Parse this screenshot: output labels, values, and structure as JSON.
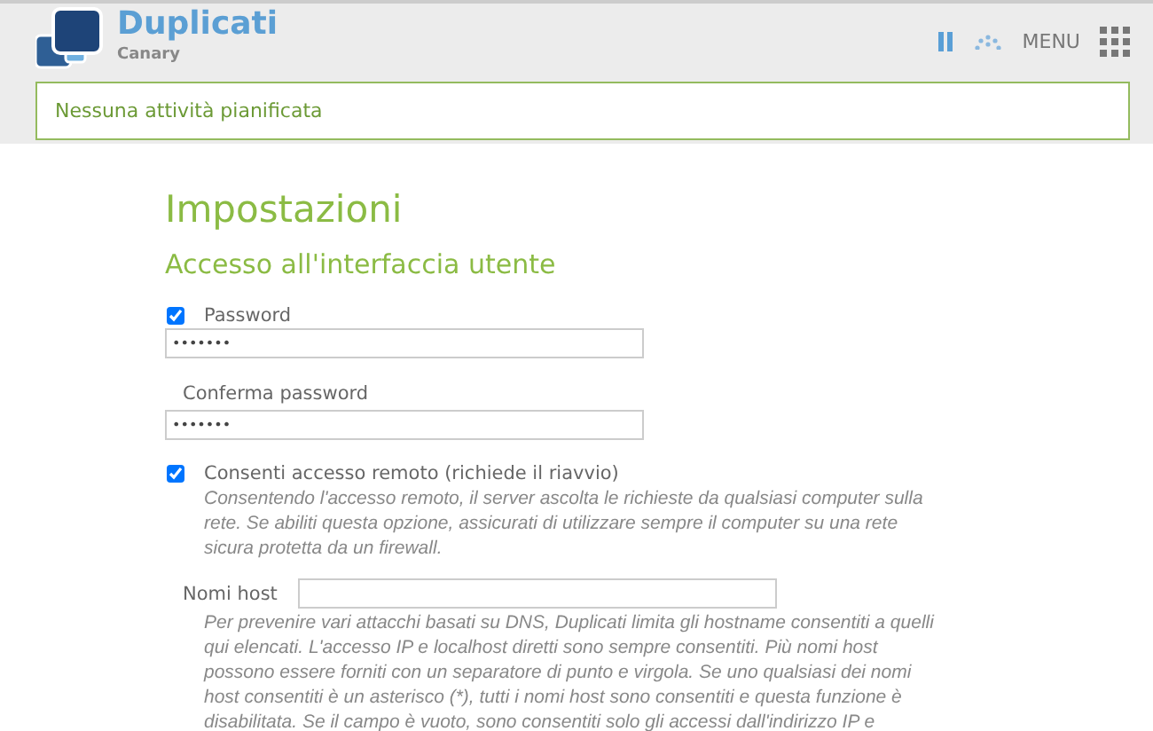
{
  "header": {
    "title": "Duplicati",
    "subtitle": "Canary",
    "paused": true,
    "menu_label": "MENU"
  },
  "status_banner": {
    "text": "Nessuna attività pianificata"
  },
  "page": {
    "title": "Impostazioni",
    "section": "Accesso all'interfaccia utente"
  },
  "settings": [
    {
      "kind": "password",
      "label": "Password",
      "checked": true,
      "value": "•••••••"
    },
    {
      "kind": "confirm",
      "label": "Conferma password",
      "value": "•••••••"
    },
    {
      "kind": "toggle",
      "label": "Consenti accesso remoto (richiede il riavvio)",
      "checked": true,
      "description": "Consentendo l'accesso remoto, il server ascolta le richieste da qualsiasi computer sulla rete. Se abiliti questa opzione, assicurati di utilizzare sempre il computer su una rete sicura protetta da un firewall."
    },
    {
      "kind": "hosts",
      "label": "Nomi host",
      "description": "Per prevenire vari attacchi basati su DNS, Duplicati limita gli hostname consentiti a quelli qui elencati. L'accesso IP e localhost diretti sono sempre consentiti. Più nomi host possono essere forniti con un separatore di punto e virgola. Se uno qualsiasi dei nomi host consentiti è un asterisco (*), tutti i nomi host sono consentiti e questa funzione è disabilitata. Se il campo è vuoto, sono consentiti solo gli accessi dall'indirizzo IP e"
    }
  ]
}
